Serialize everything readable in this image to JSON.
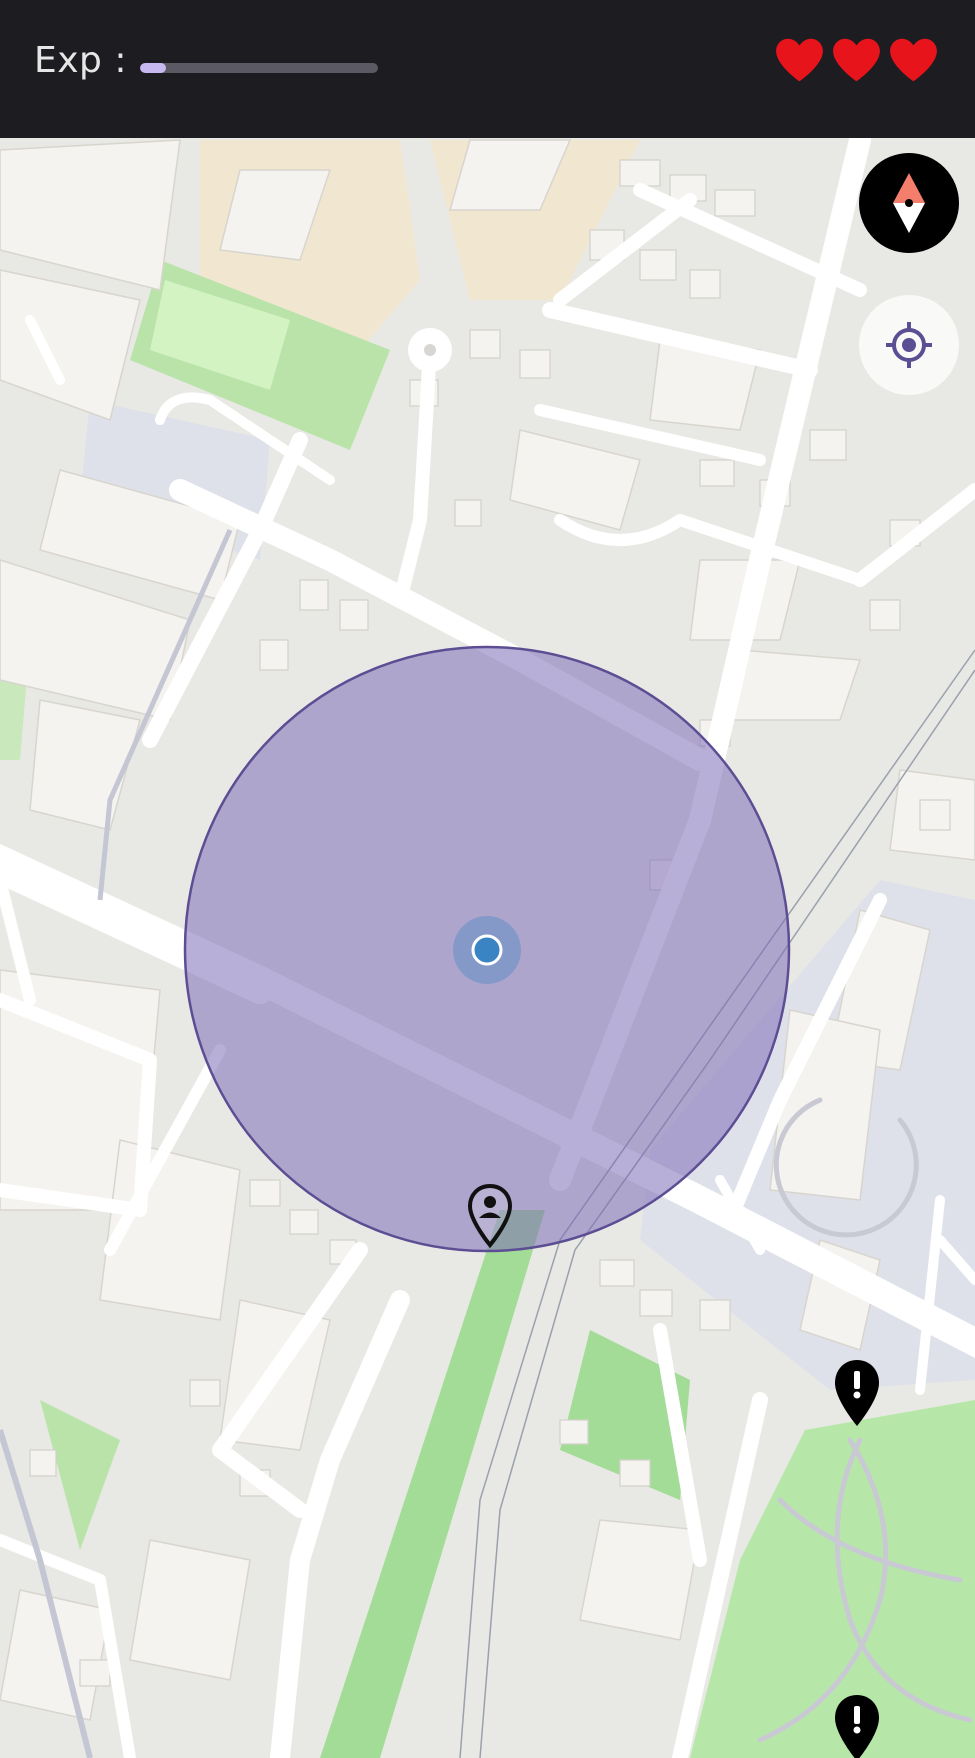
{
  "header": {
    "exp_label": "Exp :",
    "exp_progress": 0.11,
    "lives": 3,
    "heart_color": "#e8141c"
  },
  "map": {
    "radius_color": "#7e6db8",
    "user_location_color": "#3a84c4",
    "park_color": "#b7e7a8"
  },
  "controls": {
    "compass_icon": "compass-icon",
    "locate_icon": "crosshair-icon"
  },
  "markers": [
    {
      "icon": "person-pin-icon"
    },
    {
      "icon": "alert-pin-icon"
    },
    {
      "icon": "alert-pin-icon"
    }
  ]
}
